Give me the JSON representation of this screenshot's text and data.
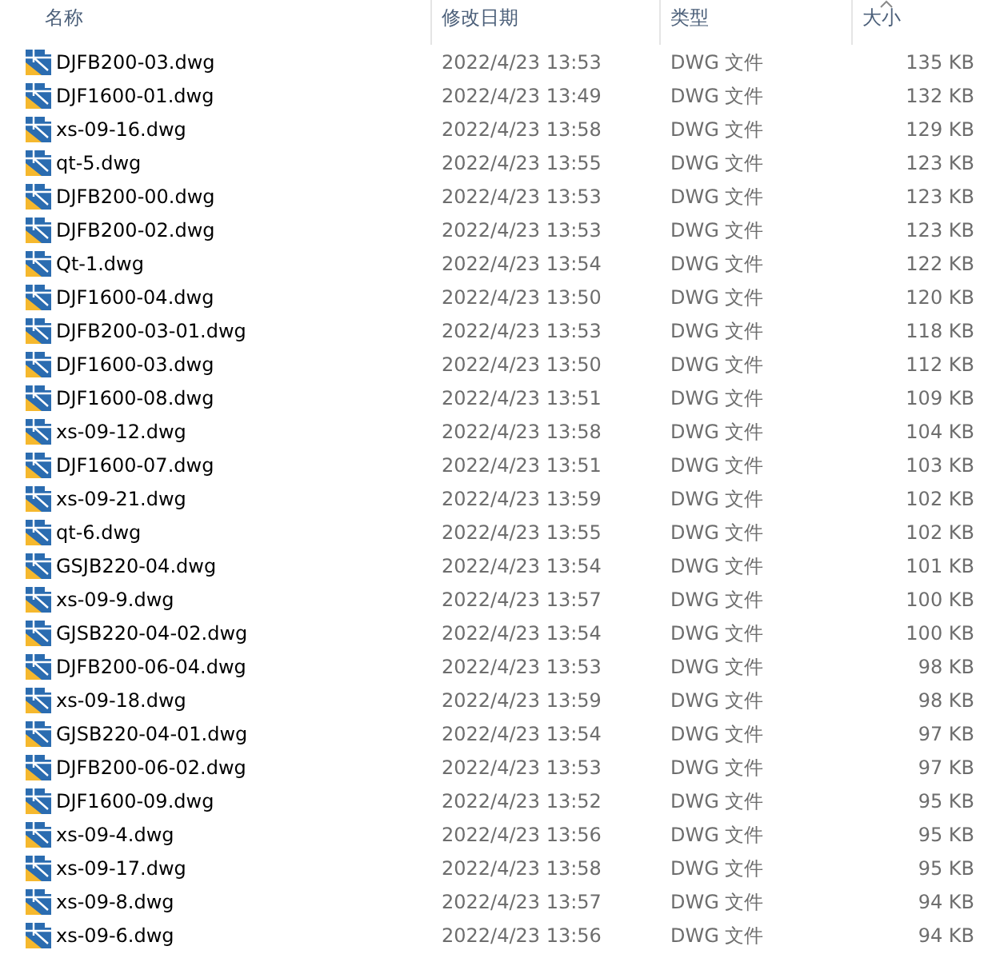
{
  "columns": [
    {
      "label": "名称"
    },
    {
      "label": "修改日期"
    },
    {
      "label": "类型"
    },
    {
      "label": "大小",
      "sorted": true
    }
  ],
  "files": [
    {
      "name": "DJFB200-03.dwg",
      "modified": "2022/4/23 13:53",
      "type": "DWG 文件",
      "size": "135 KB"
    },
    {
      "name": "DJF1600-01.dwg",
      "modified": "2022/4/23 13:49",
      "type": "DWG 文件",
      "size": "132 KB"
    },
    {
      "name": "xs-09-16.dwg",
      "modified": "2022/4/23 13:58",
      "type": "DWG 文件",
      "size": "129 KB"
    },
    {
      "name": "qt-5.dwg",
      "modified": "2022/4/23 13:55",
      "type": "DWG 文件",
      "size": "123 KB"
    },
    {
      "name": "DJFB200-00.dwg",
      "modified": "2022/4/23 13:53",
      "type": "DWG 文件",
      "size": "123 KB"
    },
    {
      "name": "DJFB200-02.dwg",
      "modified": "2022/4/23 13:53",
      "type": "DWG 文件",
      "size": "123 KB"
    },
    {
      "name": "Qt-1.dwg",
      "modified": "2022/4/23 13:54",
      "type": "DWG 文件",
      "size": "122 KB"
    },
    {
      "name": "DJF1600-04.dwg",
      "modified": "2022/4/23 13:50",
      "type": "DWG 文件",
      "size": "120 KB"
    },
    {
      "name": "DJFB200-03-01.dwg",
      "modified": "2022/4/23 13:53",
      "type": "DWG 文件",
      "size": "118 KB"
    },
    {
      "name": "DJF1600-03.dwg",
      "modified": "2022/4/23 13:50",
      "type": "DWG 文件",
      "size": "112 KB"
    },
    {
      "name": "DJF1600-08.dwg",
      "modified": "2022/4/23 13:51",
      "type": "DWG 文件",
      "size": "109 KB"
    },
    {
      "name": "xs-09-12.dwg",
      "modified": "2022/4/23 13:58",
      "type": "DWG 文件",
      "size": "104 KB"
    },
    {
      "name": "DJF1600-07.dwg",
      "modified": "2022/4/23 13:51",
      "type": "DWG 文件",
      "size": "103 KB"
    },
    {
      "name": "xs-09-21.dwg",
      "modified": "2022/4/23 13:59",
      "type": "DWG 文件",
      "size": "102 KB"
    },
    {
      "name": "qt-6.dwg",
      "modified": "2022/4/23 13:55",
      "type": "DWG 文件",
      "size": "102 KB"
    },
    {
      "name": "GSJB220-04.dwg",
      "modified": "2022/4/23 13:54",
      "type": "DWG 文件",
      "size": "101 KB"
    },
    {
      "name": "xs-09-9.dwg",
      "modified": "2022/4/23 13:57",
      "type": "DWG 文件",
      "size": "100 KB"
    },
    {
      "name": "GJSB220-04-02.dwg",
      "modified": "2022/4/23 13:54",
      "type": "DWG 文件",
      "size": "100 KB"
    },
    {
      "name": "DJFB200-06-04.dwg",
      "modified": "2022/4/23 13:53",
      "type": "DWG 文件",
      "size": "98 KB"
    },
    {
      "name": "xs-09-18.dwg",
      "modified": "2022/4/23 13:59",
      "type": "DWG 文件",
      "size": "98 KB"
    },
    {
      "name": "GJSB220-04-01.dwg",
      "modified": "2022/4/23 13:54",
      "type": "DWG 文件",
      "size": "97 KB"
    },
    {
      "name": "DJFB200-06-02.dwg",
      "modified": "2022/4/23 13:53",
      "type": "DWG 文件",
      "size": "97 KB"
    },
    {
      "name": "DJF1600-09.dwg",
      "modified": "2022/4/23 13:52",
      "type": "DWG 文件",
      "size": "95 KB"
    },
    {
      "name": "xs-09-4.dwg",
      "modified": "2022/4/23 13:56",
      "type": "DWG 文件",
      "size": "95 KB"
    },
    {
      "name": "xs-09-17.dwg",
      "modified": "2022/4/23 13:58",
      "type": "DWG 文件",
      "size": "95 KB"
    },
    {
      "name": "xs-09-8.dwg",
      "modified": "2022/4/23 13:57",
      "type": "DWG 文件",
      "size": "94 KB"
    },
    {
      "name": "xs-09-6.dwg",
      "modified": "2022/4/23 13:56",
      "type": "DWG 文件",
      "size": "94 KB"
    }
  ]
}
